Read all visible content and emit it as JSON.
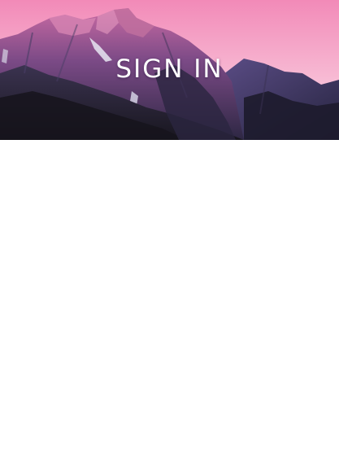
{
  "header": {
    "title": "SIGN IN",
    "background_image": "mountain-sunset-image"
  },
  "colors": {
    "sky_top": "#f489b8",
    "sky_bottom": "#fbe1ec",
    "mountain_light": "#a2558f",
    "mountain_dark": "#1f1d32",
    "title_text": "#ffffff",
    "page_background": "#ffffff"
  }
}
